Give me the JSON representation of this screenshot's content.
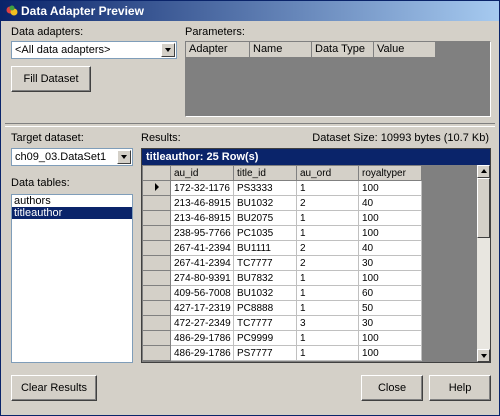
{
  "window": {
    "title": "Data Adapter Preview"
  },
  "adapters": {
    "label": "Data adapters:",
    "selected": "<All data adapters>"
  },
  "fill_button": "Fill Dataset",
  "parameters": {
    "label": "Parameters:",
    "columns": [
      "Adapter",
      "Name",
      "Data Type",
      "Value"
    ]
  },
  "target": {
    "label": "Target dataset:",
    "selected": "ch09_03.DataSet1"
  },
  "tables": {
    "label": "Data tables:",
    "items": [
      "authors",
      "titleauthor"
    ],
    "selected_index": 1
  },
  "results": {
    "label": "Results:",
    "dataset_size": "Dataset Size: 10993 bytes (10.7 Kb)",
    "caption": "titleauthor: 25 Row(s)",
    "columns": [
      "au_id",
      "title_id",
      "au_ord",
      "royaltyper"
    ],
    "rows": [
      [
        "172-32-1176",
        "PS3333",
        "1",
        "100"
      ],
      [
        "213-46-8915",
        "BU1032",
        "2",
        "40"
      ],
      [
        "213-46-8915",
        "BU2075",
        "1",
        "100"
      ],
      [
        "238-95-7766",
        "PC1035",
        "1",
        "100"
      ],
      [
        "267-41-2394",
        "BU1111",
        "2",
        "40"
      ],
      [
        "267-41-2394",
        "TC7777",
        "2",
        "30"
      ],
      [
        "274-80-9391",
        "BU7832",
        "1",
        "100"
      ],
      [
        "409-56-7008",
        "BU1032",
        "1",
        "60"
      ],
      [
        "427-17-2319",
        "PC8888",
        "1",
        "50"
      ],
      [
        "472-27-2349",
        "TC7777",
        "3",
        "30"
      ],
      [
        "486-29-1786",
        "PC9999",
        "1",
        "100"
      ],
      [
        "486-29-1786",
        "PS7777",
        "1",
        "100"
      ]
    ]
  },
  "buttons": {
    "clear": "Clear Results",
    "close": "Close",
    "help": "Help"
  }
}
